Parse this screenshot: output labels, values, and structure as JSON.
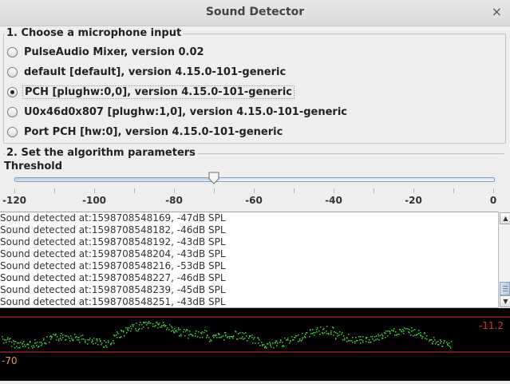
{
  "window": {
    "title": "Sound Detector",
    "close_glyph": "×"
  },
  "section1": {
    "title": "1. Choose a microphone input",
    "options": [
      {
        "label": "PulseAudio Mixer, version 0.02",
        "selected": false
      },
      {
        "label": "default [default], version 4.15.0-101-generic",
        "selected": false
      },
      {
        "label": "PCH [plughw:0,0], version 4.15.0-101-generic",
        "selected": true
      },
      {
        "label": "U0x46d0x807 [plughw:1,0], version 4.15.0-101-generic",
        "selected": false
      },
      {
        "label": "Port PCH [hw:0], version 4.15.0-101-generic",
        "selected": false
      }
    ]
  },
  "section2": {
    "title": "2. Set the algorithm parameters",
    "threshold": {
      "label": "Threshold",
      "value": -70,
      "min": -120,
      "max": 0,
      "tick_labels": [
        "-120",
        "-100",
        "-80",
        "-60",
        "-40",
        "-20",
        "0"
      ]
    }
  },
  "log": {
    "lines": [
      "Sound detected at:1598708548169, -47dB SPL",
      "Sound detected at:1598708548182, -46dB SPL",
      "Sound detected at:1598708548192, -43dB SPL",
      "Sound detected at:1598708548204, -43dB SPL",
      "Sound detected at:1598708548216, -53dB SPL",
      "Sound detected at:1598708548227, -46dB SPL",
      "Sound detected at:1598708548239, -45dB SPL",
      "Sound detected at:1598708548251, -43dB SPL"
    ],
    "scrollbar": {
      "up_icon": "arrow-up-icon",
      "down_icon": "arrow-down-icon"
    }
  },
  "scope": {
    "top_value_label": "-11.2",
    "bottom_value_label": "-70",
    "colors": {
      "background": "#000000",
      "line": "#d43a2a",
      "trace": "#3ccf3c",
      "top_label": "#d43a2a",
      "bottom_label": "#e0a030"
    }
  }
}
